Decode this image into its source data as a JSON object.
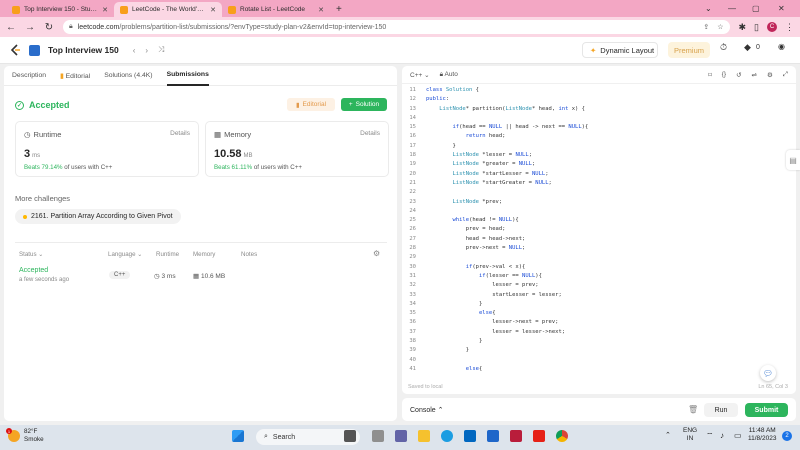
{
  "browser": {
    "tabs": [
      {
        "title": "Top Interview 150 - Study Plan",
        "active": false
      },
      {
        "title": "LeetCode - The World's Leading",
        "active": true
      },
      {
        "title": "Rotate List - LeetCode",
        "active": false
      }
    ],
    "url_host": "leetcode.com",
    "url_path": "/problems/partition-list/submissions/?envType=study-plan-v2&envId=top-interview-150",
    "profile_initial": "C"
  },
  "header": {
    "title": "Top Interview 150",
    "dynamic_layout": "Dynamic Layout",
    "premium": "Premium",
    "notifications": "0"
  },
  "left": {
    "tabs": [
      "Description",
      "Editorial",
      "Solutions (4.4K)",
      "Submissions"
    ],
    "status": "Accepted",
    "editorial_btn": "Editorial",
    "solution_btn": "Solution",
    "runtime": {
      "label": "Runtime",
      "details": "Details",
      "value": "3",
      "unit": "ms",
      "beats": "Beats 79.14%",
      "suffix": "of users with C++"
    },
    "memory": {
      "label": "Memory",
      "details": "Details",
      "value": "10.58",
      "unit": "MB",
      "beats": "Beats 61.11%",
      "suffix": "of users with C++"
    },
    "more_challenges": "More challenges",
    "challenge": "2161. Partition Array According to Given Pivot",
    "table": {
      "headers": [
        "Status",
        "Language",
        "Runtime",
        "Memory",
        "Notes"
      ],
      "row": {
        "status": "Accepted",
        "time": "a few seconds ago",
        "language": "C++",
        "runtime": "3 ms",
        "memory": "10.6 MB"
      }
    }
  },
  "editor": {
    "language": "C++",
    "mode": "Auto",
    "saved": "Saved to local",
    "position": "Ln 65, Col 3",
    "lines": [
      {
        "n": "11",
        "t": "class Solution {"
      },
      {
        "n": "12",
        "t": "public:"
      },
      {
        "n": "13",
        "t": "    ListNode* partition(ListNode* head, int x) {"
      },
      {
        "n": "14",
        "t": ""
      },
      {
        "n": "15",
        "t": "        if(head == NULL || head -> next == NULL){"
      },
      {
        "n": "16",
        "t": "            return head;"
      },
      {
        "n": "17",
        "t": "        }"
      },
      {
        "n": "18",
        "t": "        ListNode *lesser = NULL;"
      },
      {
        "n": "19",
        "t": "        ListNode *greater = NULL;"
      },
      {
        "n": "20",
        "t": "        ListNode *startLesser = NULL;"
      },
      {
        "n": "21",
        "t": "        ListNode *startGreater = NULL;"
      },
      {
        "n": "22",
        "t": ""
      },
      {
        "n": "23",
        "t": "        ListNode *prev;"
      },
      {
        "n": "24",
        "t": ""
      },
      {
        "n": "25",
        "t": "        while(head != NULL){"
      },
      {
        "n": "26",
        "t": "            prev = head;"
      },
      {
        "n": "27",
        "t": "            head = head->next;"
      },
      {
        "n": "28",
        "t": "            prev->next = NULL;"
      },
      {
        "n": "29",
        "t": ""
      },
      {
        "n": "30",
        "t": "            if(prev->val < x){"
      },
      {
        "n": "31",
        "t": "                if(lesser == NULL){"
      },
      {
        "n": "32",
        "t": "                    lesser = prev;"
      },
      {
        "n": "33",
        "t": "                    startLesser = lesser;"
      },
      {
        "n": "34",
        "t": "                }"
      },
      {
        "n": "35",
        "t": "                else{"
      },
      {
        "n": "36",
        "t": "                    lesser->next = prev;"
      },
      {
        "n": "37",
        "t": "                    lesser = lesser->next;"
      },
      {
        "n": "38",
        "t": "                }"
      },
      {
        "n": "39",
        "t": "            }"
      },
      {
        "n": "40",
        "t": ""
      },
      {
        "n": "41",
        "t": "            else{"
      }
    ]
  },
  "console": {
    "label": "Console",
    "run": "Run",
    "submit": "Submit"
  },
  "taskbar": {
    "temp": "82°F",
    "weather": "Smoke",
    "search": "Search",
    "lang1": "ENG",
    "lang2": "IN",
    "time": "11:48 AM",
    "date": "11/8/2023"
  }
}
